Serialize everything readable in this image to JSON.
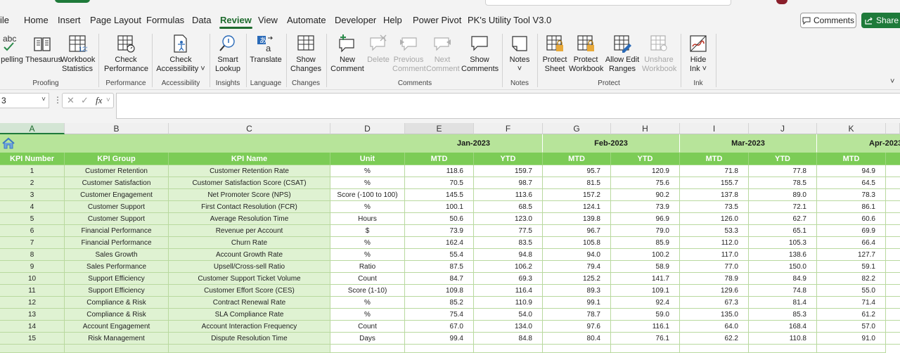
{
  "menu": {
    "tabs": [
      "ile",
      "Home",
      "Insert",
      "Page Layout",
      "Formulas",
      "Data",
      "Review",
      "View",
      "Automate",
      "Developer",
      "Help",
      "Power Pivot",
      "PK's Utility Tool V3.0"
    ],
    "active_tab": "Review",
    "comments_label": "Comments",
    "share_label": "Share"
  },
  "ribbon": {
    "buttons": {
      "spelling": "pelling",
      "thesaurus": "Thesaurus",
      "workbook_statistics": [
        "Workbook",
        "Statistics"
      ],
      "check_performance": [
        "Check",
        "Performance"
      ],
      "check_accessibility": [
        "Check",
        "Accessibility"
      ],
      "smart_lookup": [
        "Smart",
        "Lookup"
      ],
      "translate": "Translate",
      "show_changes": [
        "Show",
        "Changes"
      ],
      "new_comment": [
        "New",
        "Comment"
      ],
      "delete": "Delete",
      "previous_comment": [
        "Previous",
        "Comment"
      ],
      "next_comment": [
        "Next",
        "Comment"
      ],
      "show_comments": [
        "Show",
        "Comments"
      ],
      "notes": "Notes",
      "protect_sheet": [
        "Protect",
        "Sheet"
      ],
      "protect_workbook": [
        "Protect",
        "Workbook"
      ],
      "allow_edit_ranges": [
        "Allow Edit",
        "Ranges"
      ],
      "unshare_workbook": [
        "Unshare",
        "Workbook"
      ],
      "hide_ink": [
        "Hide",
        "Ink"
      ]
    },
    "groups": [
      "Proofing",
      "Performance",
      "Accessibility",
      "Insights",
      "Language",
      "Changes",
      "Comments",
      "Notes",
      "Protect",
      "Ink"
    ]
  },
  "formula_bar": {
    "name_box": "3",
    "fx_label": "fx",
    "content": ""
  },
  "sheet": {
    "columns": [
      "A",
      "B",
      "C",
      "D",
      "E",
      "F",
      "G",
      "H",
      "I",
      "J",
      "K"
    ],
    "selected_column": "A",
    "months": [
      "Jan-2023",
      "Feb-2023",
      "Mar-2023",
      "Apr-2023"
    ],
    "headers": {
      "kpi_number": "KPI Number",
      "kpi_group": "KPI Group",
      "kpi_name": "KPI Name",
      "unit": "Unit",
      "mtd": "MTD",
      "ytd": "YTD"
    },
    "rows": [
      {
        "num": "1",
        "group": "Customer Retention",
        "name": "Customer Retention Rate",
        "unit": "%",
        "values": [
          "118.6",
          "159.7",
          "95.7",
          "120.9",
          "71.8",
          "77.8",
          "94.9"
        ]
      },
      {
        "num": "2",
        "group": "Customer Satisfaction",
        "name": "Customer Satisfaction Score (CSAT)",
        "unit": "%",
        "values": [
          "70.5",
          "98.7",
          "81.5",
          "75.6",
          "155.7",
          "78.5",
          "64.5"
        ]
      },
      {
        "num": "3",
        "group": "Customer Engagement",
        "name": "Net Promoter Score (NPS)",
        "unit": "Score (-100 to 100)",
        "values": [
          "145.5",
          "113.6",
          "157.2",
          "90.2",
          "137.8",
          "89.0",
          "78.3"
        ]
      },
      {
        "num": "4",
        "group": "Customer Support",
        "name": "First Contact Resolution (FCR)",
        "unit": "%",
        "values": [
          "100.1",
          "68.5",
          "124.1",
          "73.9",
          "73.5",
          "72.1",
          "86.1"
        ]
      },
      {
        "num": "5",
        "group": "Customer Support",
        "name": "Average Resolution Time",
        "unit": "Hours",
        "values": [
          "50.6",
          "123.0",
          "139.8",
          "96.9",
          "126.0",
          "62.7",
          "60.6"
        ]
      },
      {
        "num": "6",
        "group": "Financial Performance",
        "name": "Revenue per Account",
        "unit": "$",
        "values": [
          "73.9",
          "77.5",
          "96.7",
          "79.0",
          "53.3",
          "65.1",
          "69.9"
        ]
      },
      {
        "num": "7",
        "group": "Financial Performance",
        "name": "Churn Rate",
        "unit": "%",
        "values": [
          "162.4",
          "83.5",
          "105.8",
          "85.9",
          "112.0",
          "105.3",
          "66.4"
        ]
      },
      {
        "num": "8",
        "group": "Sales Growth",
        "name": "Account Growth Rate",
        "unit": "%",
        "values": [
          "55.4",
          "94.8",
          "94.0",
          "100.2",
          "117.0",
          "138.6",
          "127.7"
        ]
      },
      {
        "num": "9",
        "group": "Sales Performance",
        "name": "Upsell/Cross-sell Ratio",
        "unit": "Ratio",
        "values": [
          "87.5",
          "106.2",
          "79.4",
          "58.9",
          "77.0",
          "150.0",
          "59.1"
        ]
      },
      {
        "num": "10",
        "group": "Support Efficiency",
        "name": "Customer Support Ticket Volume",
        "unit": "Count",
        "values": [
          "84.7",
          "69.3",
          "125.2",
          "141.7",
          "78.9",
          "84.9",
          "82.2"
        ]
      },
      {
        "num": "11",
        "group": "Support Efficiency",
        "name": "Customer Effort Score (CES)",
        "unit": "Score (1-10)",
        "values": [
          "109.8",
          "116.4",
          "89.3",
          "109.1",
          "129.6",
          "74.8",
          "55.0"
        ]
      },
      {
        "num": "12",
        "group": "Compliance & Risk",
        "name": "Contract Renewal Rate",
        "unit": "%",
        "values": [
          "85.2",
          "110.9",
          "99.1",
          "92.4",
          "67.3",
          "81.4",
          "71.4"
        ]
      },
      {
        "num": "13",
        "group": "Compliance & Risk",
        "name": "SLA Compliance Rate",
        "unit": "%",
        "values": [
          "75.4",
          "54.0",
          "78.7",
          "59.0",
          "135.0",
          "85.3",
          "61.2"
        ]
      },
      {
        "num": "14",
        "group": "Account Engagement",
        "name": "Account Interaction Frequency",
        "unit": "Count",
        "values": [
          "67.0",
          "134.0",
          "97.6",
          "116.1",
          "64.0",
          "168.4",
          "57.0"
        ]
      },
      {
        "num": "15",
        "group": "Risk Management",
        "name": "Dispute Resolution Time",
        "unit": "Days",
        "values": [
          "99.4",
          "84.8",
          "80.4",
          "76.1",
          "62.2",
          "110.8",
          "91.0"
        ]
      }
    ]
  },
  "colors": {
    "accent": "#1e6b2e",
    "header_light": "#b7e49a",
    "header_dark": "#7ccc56",
    "label_fill": "#dff2d2"
  }
}
